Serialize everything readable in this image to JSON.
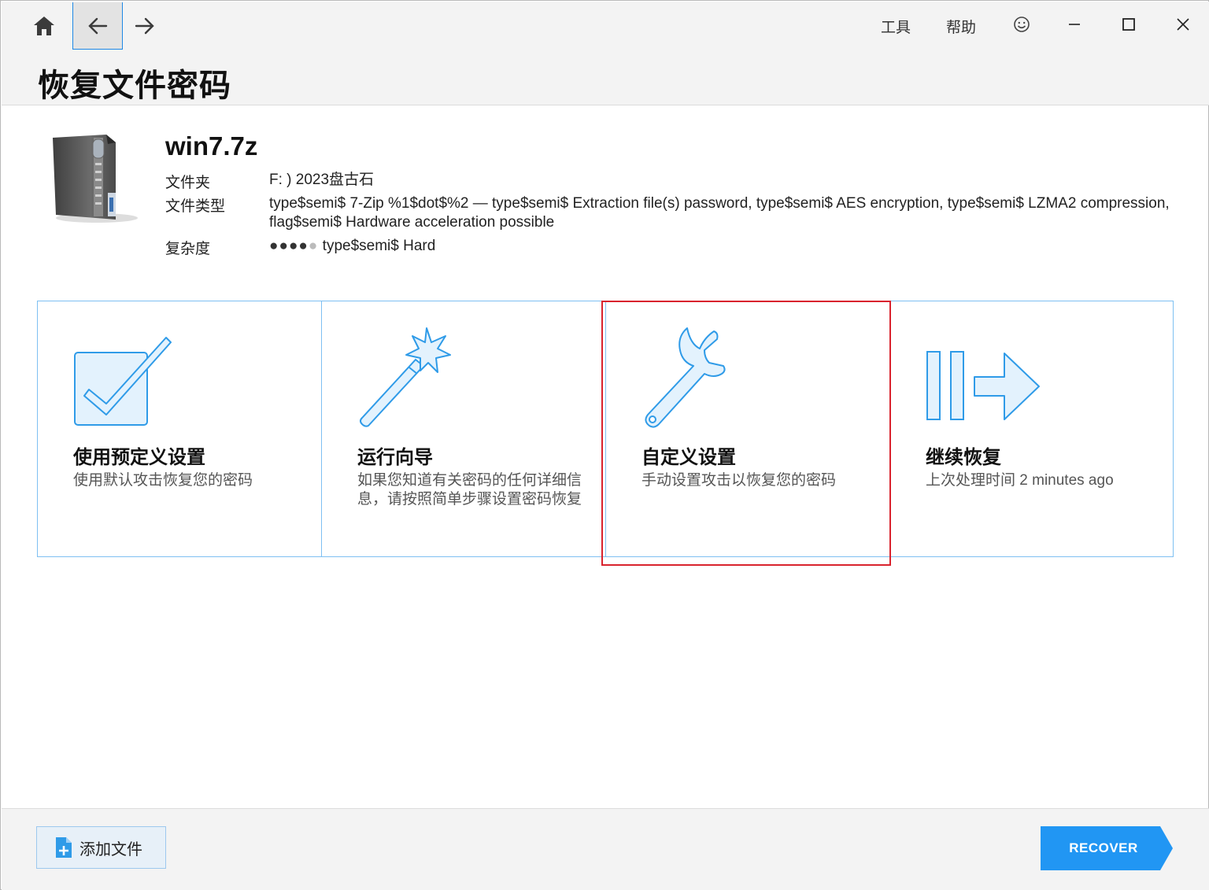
{
  "header": {
    "title": "恢复文件密码",
    "menu_tools": "工具",
    "menu_help": "帮助"
  },
  "file": {
    "name": "win7.7z",
    "folder_label": "文件夹",
    "folder_value": "F: ) 2023盘古石",
    "type_label": "文件类型",
    "type_value": "type$semi$ 7-Zip %1$dot$%2 — type$semi$ Extraction file(s) password, type$semi$ AES encryption, type$semi$ LZMA2 compression, flag$semi$ Hardware acceleration possible",
    "complexity_label": "复杂度",
    "complexity_dots_filled": "●●●●",
    "complexity_dots_empty": "●",
    "complexity_value": "type$semi$ Hard",
    "complexity_level": 4,
    "complexity_max": 5
  },
  "options": [
    {
      "title": "使用预定义设置",
      "desc": "使用默认攻击恢复您的密码",
      "icon": "checkbox-icon"
    },
    {
      "title": "运行向导",
      "desc": "如果您知道有关密码的任何详细信息，请按照简单步骤设置密码恢复",
      "icon": "magic-wand-icon"
    },
    {
      "title": "自定义设置",
      "desc": "手动设置攻击以恢复您的密码",
      "icon": "wrench-icon"
    },
    {
      "title": "继续恢复",
      "desc": "上次处理时间 2 minutes ago",
      "icon": "resume-icon"
    }
  ],
  "footer": {
    "add_file": "添加文件",
    "recover": "RECOVER"
  },
  "colors": {
    "accent": "#1e88e5",
    "icon_stroke": "#2f9be8",
    "icon_fill": "#e3f2fd",
    "highlight": "#d9232e"
  }
}
